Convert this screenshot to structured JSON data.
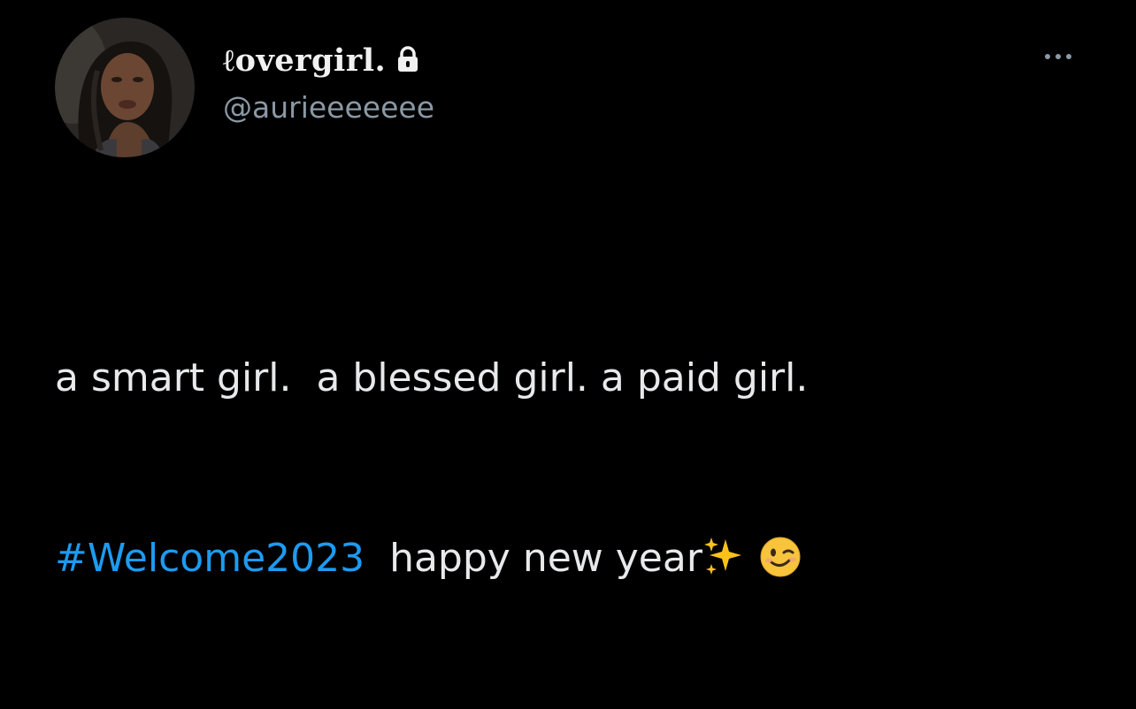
{
  "author": {
    "display_name": "ℓovergirl.",
    "handle": "@aurieeeeeee",
    "protected": true
  },
  "tweet": {
    "line1": "a smart girl.  a blessed girl. a paid girl.",
    "hashtag": "#Welcome2023",
    "line2_text": "  happy new year",
    "emojis": [
      "sparkles-icon",
      "winking-face-icon"
    ]
  },
  "icons": {
    "lock": "lock-icon",
    "more": "more-options-icon"
  },
  "colors": {
    "background": "#000000",
    "text": "#e7e9ea",
    "secondary": "#8b98a5",
    "accent": "#1d9bf0"
  }
}
